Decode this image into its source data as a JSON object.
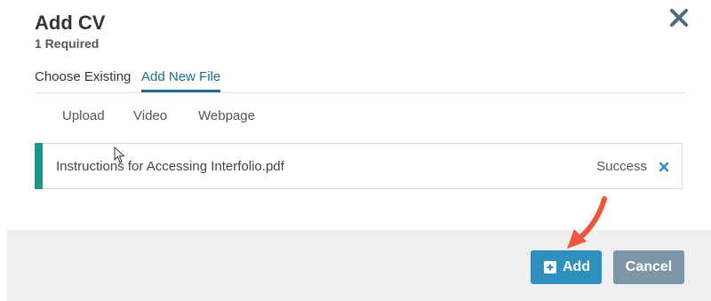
{
  "dialog": {
    "title": "Add CV",
    "subtitle": "1 Required"
  },
  "tabs": [
    {
      "label": "Choose Existing",
      "active": false
    },
    {
      "label": "Add New File",
      "active": true
    }
  ],
  "subtabs": [
    {
      "label": "Upload"
    },
    {
      "label": "Video"
    },
    {
      "label": "Webpage"
    }
  ],
  "file": {
    "name": "Instructions for Accessing Interfolio.pdf",
    "status": "Success"
  },
  "footer": {
    "add_label": "Add",
    "cancel_label": "Cancel"
  },
  "colors": {
    "accent": "#14998f",
    "primary": "#2f8fbf",
    "secondary": "#7d96a8",
    "active_tab": "#1e6c8f",
    "annotation_arrow": "#e9573f"
  },
  "icons": {
    "close": "close-icon",
    "remove": "remove-file-icon",
    "add": "plus-square-icon",
    "annotation": "arrow-icon"
  }
}
